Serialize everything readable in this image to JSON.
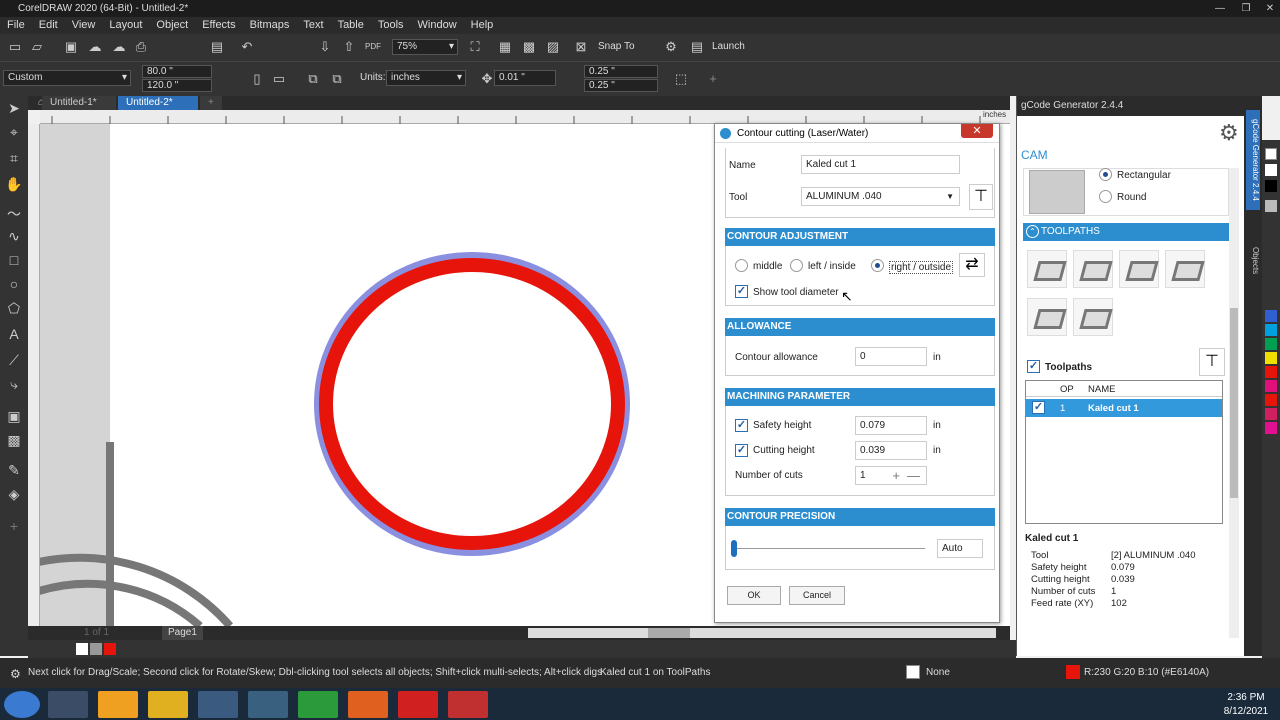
{
  "window": {
    "title": "CorelDRAW 2020 (64-Bit) - Untitled-2*"
  },
  "menu": [
    "File",
    "Edit",
    "View",
    "Layout",
    "Object",
    "Effects",
    "Bitmaps",
    "Text",
    "Table",
    "Tools",
    "Window",
    "Help"
  ],
  "standard_toolbar": {
    "zoom": "75%",
    "snap_to": "Snap To",
    "launch": "Launch"
  },
  "property_bar": {
    "preset": "Custom",
    "width": "80.0 \"",
    "height": "120.0 \"",
    "units_label": "Units:",
    "units": "inches",
    "nudge": "0.01 \"",
    "dup_x": "0.25 \"",
    "dup_y": "0.25 \""
  },
  "doc_tabs": [
    "Untitled-1*",
    "Untitled-2*"
  ],
  "ruler_unit": "inches",
  "page_tabs": {
    "pages": "1 of 1",
    "page": "Page1"
  },
  "dialog": {
    "title": "Contour cutting (Laser/Water)",
    "name_label": "Name",
    "name_value": "Kaled  cut 1",
    "tool_label": "Tool",
    "tool_value": "ALUMINUM .040",
    "section_contour": "CONTOUR ADJUSTMENT",
    "radio_middle": "middle",
    "radio_left": "left / inside",
    "radio_right": "right / outside",
    "show_tool_diameter": "Show tool diameter",
    "section_allowance": "ALLOWANCE",
    "allowance_label": "Contour allowance",
    "allowance_value": "0",
    "unit": "in",
    "section_machining": "MACHINING PARAMETER",
    "safety_label": "Safety height",
    "safety_value": "0.079",
    "cutting_label": "Cutting height",
    "cutting_value": "0.039",
    "cuts_label": "Number of cuts",
    "cuts_value": "1",
    "section_precision": "CONTOUR PRECISION",
    "precision_value": "Auto",
    "ok": "OK",
    "cancel": "Cancel"
  },
  "gcode_panel": {
    "title": "gCode Generator 2.4.4",
    "cam_tab": "CAM",
    "shape_rect": "Rectangular",
    "shape_round": "Round",
    "toolpaths_section": "TOOLPATHS",
    "toolpaths_label": "Toolpaths",
    "col_op": "OP",
    "col_name": "NAME",
    "row_op": "1",
    "row_name": "Kaled  cut 1",
    "details_title": "Kaled  cut 1",
    "details": [
      {
        "k": "Tool",
        "v": "[2] ALUMINUM .040"
      },
      {
        "k": "Safety height",
        "v": "0.079"
      },
      {
        "k": "Cutting height",
        "v": "0.039"
      },
      {
        "k": "Number of cuts",
        "v": "1"
      },
      {
        "k": "Feed rate (XY)",
        "v": "102"
      }
    ]
  },
  "docker_tabs": [
    "gCode Generator 2.4.4",
    "Objects"
  ],
  "status": {
    "hint": "Next click for Drag/Scale; Second click for Rotate/Skew; Dbl-clicking tool selects all objects; Shift+click multi-selects; Alt+click digs",
    "object": "Kaled  cut 1 on ToolPaths",
    "fill": "None",
    "outline_color": "R:230 G:20 B:10 (#E6140A)"
  },
  "clock": {
    "time": "2:36 PM",
    "date": "8/12/2021"
  },
  "colors": {
    "accent": "#2d8ecf",
    "cut_red": "#e6140a",
    "tool_blue": "#8a8fe0"
  }
}
